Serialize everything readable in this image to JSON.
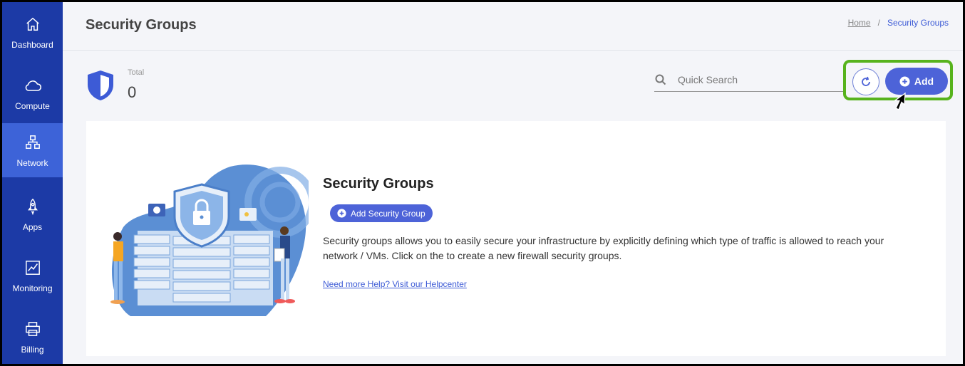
{
  "sidebar": {
    "items": [
      {
        "label": "Dashboard",
        "icon": "home-icon",
        "active": false
      },
      {
        "label": "Compute",
        "icon": "cloud-icon",
        "active": false
      },
      {
        "label": "Network",
        "icon": "network-icon",
        "active": true
      },
      {
        "label": "Apps",
        "icon": "rocket-icon",
        "active": false
      },
      {
        "label": "Monitoring",
        "icon": "chart-line-icon",
        "active": false
      },
      {
        "label": "Billing",
        "icon": "printer-icon",
        "active": false
      }
    ]
  },
  "header": {
    "title": "Security Groups",
    "breadcrumb": {
      "home": "Home",
      "separator": "/",
      "current": "Security Groups"
    }
  },
  "stats": {
    "total_label": "Total",
    "total_value": "0"
  },
  "search": {
    "placeholder": "Quick Search",
    "value": ""
  },
  "toolbar": {
    "refresh_icon": "refresh-icon",
    "add_label": "Add",
    "add_icon": "plus-circle-icon"
  },
  "empty_state": {
    "title": "Security Groups",
    "add_button_label": "Add Security Group",
    "description": "Security groups allows you to easily secure your infrastructure by explicitly defining which type of traffic is allowed to reach your network / VMs. Click on the to create a new firewall security groups.",
    "help_link": "Need more Help? Visit our Helpcenter"
  },
  "colors": {
    "sidebar_bg": "#1c3aa6",
    "sidebar_active": "#3d63d8",
    "accent": "#4d63d8",
    "highlight": "#57b31d"
  }
}
